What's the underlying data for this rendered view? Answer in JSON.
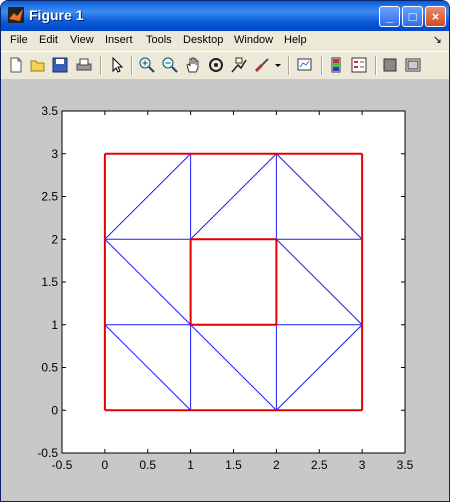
{
  "window": {
    "title": "Figure 1"
  },
  "title_buttons": {
    "minimize": "_",
    "maximize": "□",
    "close": "×"
  },
  "menu": [
    "File",
    "Edit",
    "View",
    "Insert",
    "Tools",
    "Desktop",
    "Window",
    "Help"
  ],
  "menu_dock_arrow": "↘",
  "toolbar": [
    "new-figure-icon",
    "open-file-icon",
    "save-icon",
    "print-icon",
    "edit-plot-arrow-icon",
    "zoom-in-icon",
    "zoom-out-icon",
    "pan-hand-icon",
    "rotate-3d-icon",
    "data-cursor-icon",
    "brush-icon",
    "brush-dropdown-icon",
    "link-plot-icon",
    "colorbar-icon",
    "legend-icon",
    "hide-plot-tools-icon",
    "show-plot-tools-icon"
  ],
  "colors": {
    "mesh": "#1a1aff",
    "boundary": "#e00000",
    "figure_bg": "#c8c8c8",
    "axes_bg": "#ffffff"
  },
  "chart_data": {
    "type": "line",
    "title": "",
    "xlabel": "",
    "ylabel": "",
    "xlim": [
      -0.5,
      3.5
    ],
    "ylim": [
      -0.5,
      3.5
    ],
    "xticks": [
      "-0.5",
      "0",
      "0.5",
      "1",
      "1.5",
      "2",
      "2.5",
      "3",
      "3.5"
    ],
    "yticks": [
      "-0.5",
      "0",
      "0.5",
      "1",
      "1.5",
      "2",
      "2.5",
      "3",
      "3.5"
    ],
    "xtick_values": [
      -0.5,
      0,
      0.5,
      1,
      1.5,
      2,
      2.5,
      3,
      3.5
    ],
    "ytick_values": [
      -0.5,
      0,
      0.5,
      1,
      1.5,
      2,
      2.5,
      3,
      3.5
    ],
    "grid": false,
    "series": [
      {
        "color": "#1a1aff",
        "segments": [
          [
            [
              0,
              1
            ],
            [
              3,
              1
            ]
          ],
          [
            [
              0,
              2
            ],
            [
              3,
              2
            ]
          ],
          [
            [
              1,
              0
            ],
            [
              1,
              3
            ]
          ],
          [
            [
              2,
              0
            ],
            [
              2,
              3
            ]
          ],
          [
            [
              0,
              1
            ],
            [
              1,
              0
            ]
          ],
          [
            [
              2,
              0
            ],
            [
              3,
              1
            ]
          ],
          [
            [
              0,
              2
            ],
            [
              1,
              3
            ]
          ],
          [
            [
              2,
              3
            ],
            [
              3,
              2
            ]
          ],
          [
            [
              0,
              2
            ],
            [
              1,
              1
            ]
          ],
          [
            [
              1,
              1
            ],
            [
              2,
              0
            ]
          ],
          [
            [
              2,
              2
            ],
            [
              3,
              1
            ]
          ],
          [
            [
              1,
              2
            ],
            [
              2,
              3
            ]
          ]
        ]
      },
      {
        "color": "#e00000",
        "segments": [
          [
            [
              0,
              0
            ],
            [
              3,
              0
            ]
          ],
          [
            [
              3,
              0
            ],
            [
              3,
              3
            ]
          ],
          [
            [
              3,
              3
            ],
            [
              0,
              3
            ]
          ],
          [
            [
              0,
              3
            ],
            [
              0,
              0
            ]
          ],
          [
            [
              1,
              1
            ],
            [
              2,
              1
            ]
          ],
          [
            [
              2,
              1
            ],
            [
              2,
              2
            ]
          ],
          [
            [
              2,
              2
            ],
            [
              1,
              2
            ]
          ],
          [
            [
              1,
              2
            ],
            [
              1,
              1
            ]
          ]
        ]
      }
    ]
  }
}
